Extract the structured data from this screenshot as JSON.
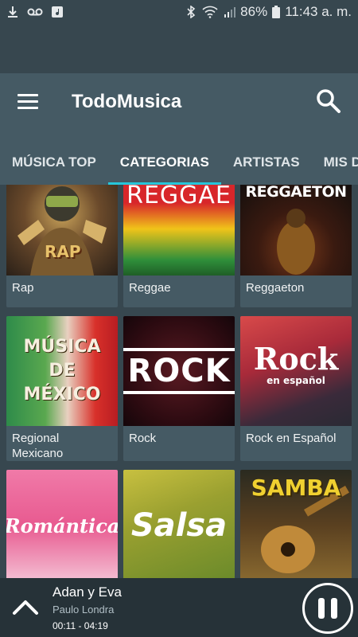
{
  "status": {
    "battery": "86%",
    "time": "11:43 a. m."
  },
  "app": {
    "title": "TodoMusica"
  },
  "tabs": [
    {
      "label": "MÚSICA TOP",
      "active": false
    },
    {
      "label": "CATEGORIAS",
      "active": true
    },
    {
      "label": "ARTISTAS",
      "active": false
    },
    {
      "label": "MIS DE",
      "active": false
    }
  ],
  "categories": [
    {
      "label": "Rap",
      "art_text": "RAP"
    },
    {
      "label": "Reggae",
      "art_text": "REGGAE"
    },
    {
      "label": "Reggaeton",
      "art_text": "REGGAETON"
    },
    {
      "label": "Regional Mexicano",
      "art_text": "MÚSICA DE MÉXICO"
    },
    {
      "label": "Rock",
      "art_text": "ROCK"
    },
    {
      "label": "Rock en Español",
      "art_text": "Rock",
      "art_subtext": "en español"
    },
    {
      "label": "",
      "art_text": "Romántica"
    },
    {
      "label": "",
      "art_text": "Salsa"
    },
    {
      "label": "",
      "art_text": "SAMBA"
    }
  ],
  "player": {
    "title": "Adan y Eva",
    "artist": "Paulo Londra",
    "time": "00:11 - 04:19"
  },
  "colors": {
    "accent": "#26c6da",
    "appbar": "#455a64",
    "background": "#37474f",
    "player": "#263238"
  }
}
